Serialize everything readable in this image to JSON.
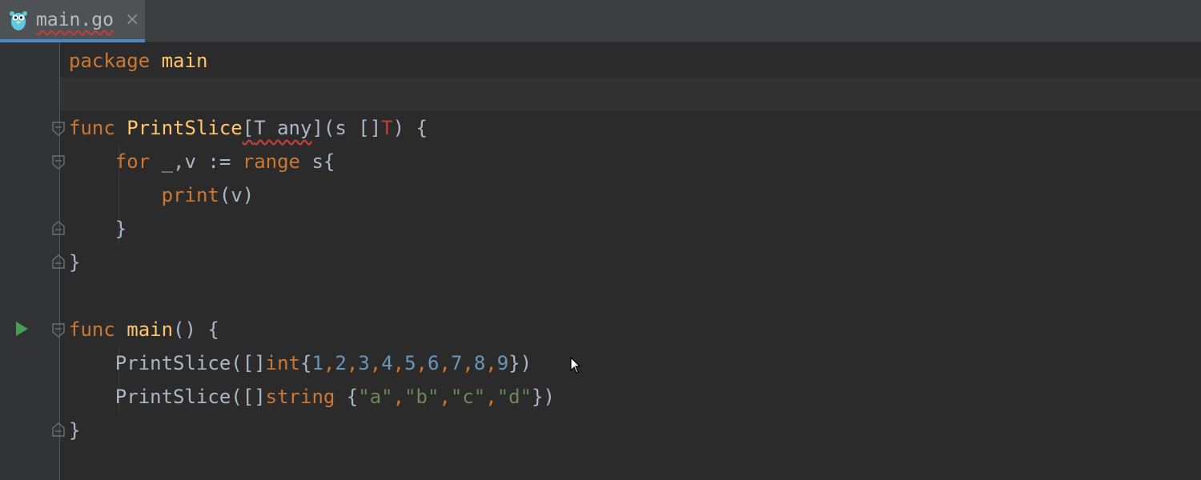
{
  "tab": {
    "filename": "main.go",
    "close_glyph": "×",
    "icon": "gopher-icon"
  },
  "code": {
    "l1": {
      "kw": "package",
      "name": "main"
    },
    "l3": {
      "kw": "func",
      "fn": "PrintSlice",
      "open": "[",
      "tparam": "T any",
      "mid": "](s []",
      "tref": "T",
      "tail": ") {"
    },
    "l4": {
      "kw1": "for",
      "mid": " _,v := ",
      "kw2": "range",
      "tail": " s{"
    },
    "l5": {
      "fn": "print",
      "tail": "(v)"
    },
    "l6": {
      "text": "}"
    },
    "l7": {
      "text": "}"
    },
    "l9": {
      "kw": "func",
      "fn": "main",
      "tail": "() {"
    },
    "l10": {
      "fn": "PrintSlice",
      "a": "([]",
      "kw": "int",
      "b": "{",
      "n1": "1",
      "n2": "2",
      "n3": "3",
      "n4": "4",
      "n5": "5",
      "n6": "6",
      "n7": "7",
      "n8": "8",
      "n9": "9",
      "comma": ",",
      "c": "})"
    },
    "l11": {
      "fn": "PrintSlice",
      "a": "([]",
      "kw": "string",
      "b": " {",
      "s1": "\"a\"",
      "s2": "\"b\"",
      "s3": "\"c\"",
      "s4": "\"d\"",
      "comma": ",",
      "c": "})"
    },
    "l12": {
      "text": "}"
    }
  },
  "colors": {
    "keyword": "#cc7832",
    "function": "#ffc66d",
    "number": "#6897bb",
    "string": "#6a8759",
    "error": "#bc3f3c",
    "run": "#499c54"
  },
  "icons": {
    "run": "run-arrow-icon",
    "fold": "fold-marker-icon",
    "cursor": "mouse-cursor-icon"
  }
}
